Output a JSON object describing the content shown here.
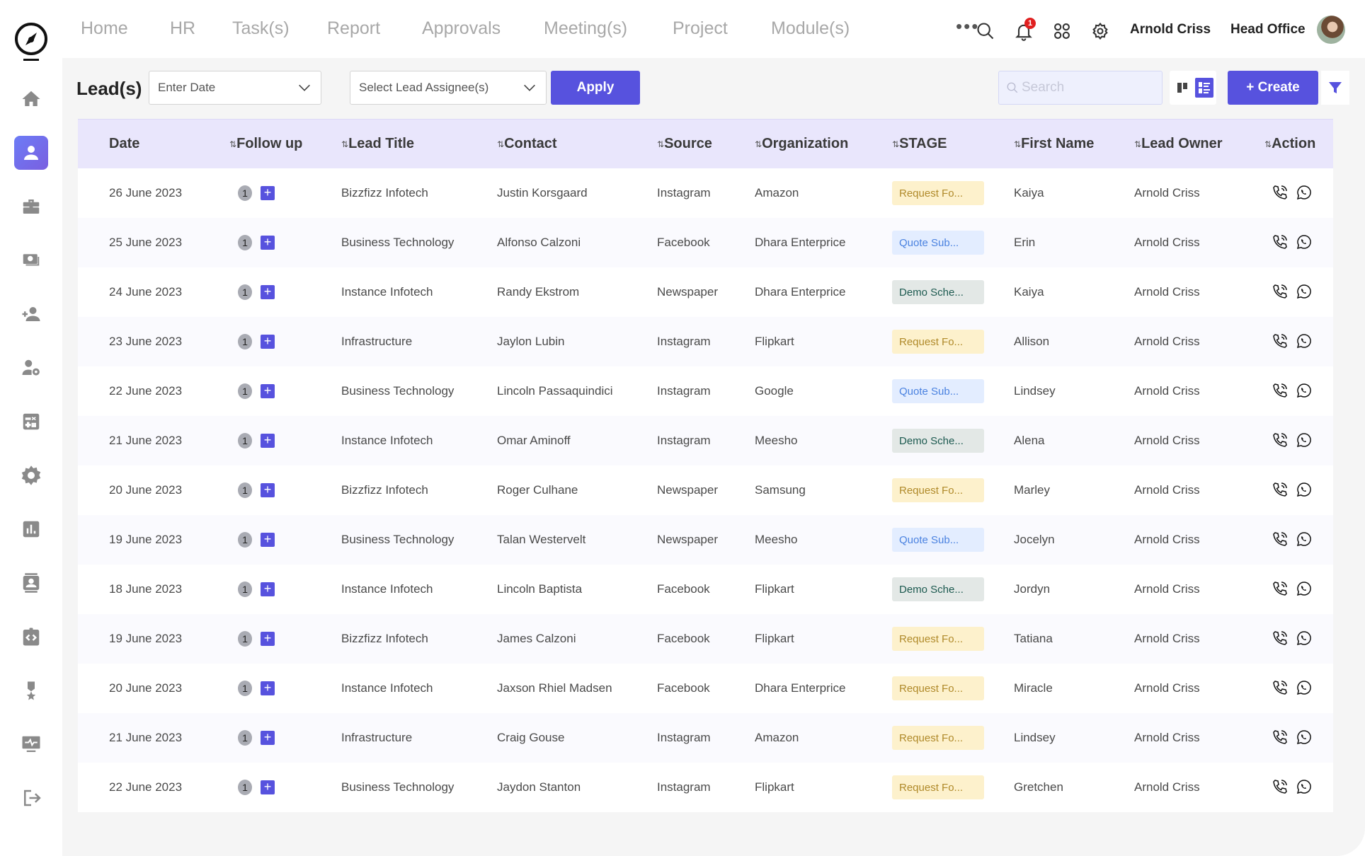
{
  "nav": {
    "links": [
      "Home",
      "HR",
      "Task(s)",
      "Report",
      "Approvals",
      "Meeting(s)",
      "Project",
      "Module(s)"
    ],
    "more_label": "•••",
    "notification_count": "1",
    "user_name": "Arnold Criss",
    "office": "Head Office"
  },
  "sidebar": {
    "items": [
      {
        "name": "home",
        "icon": "home-icon",
        "active": false
      },
      {
        "name": "leads",
        "icon": "person-icon",
        "active": true
      },
      {
        "name": "briefcase",
        "icon": "briefcase-icon",
        "active": false
      },
      {
        "name": "payments",
        "icon": "cash-icon",
        "active": false
      },
      {
        "name": "add-user",
        "icon": "person-add-icon",
        "active": false
      },
      {
        "name": "user-settings",
        "icon": "person-gear-icon",
        "active": false
      },
      {
        "name": "calculator",
        "icon": "calculator-icon",
        "active": false
      },
      {
        "name": "settings",
        "icon": "gear-icon",
        "active": false
      },
      {
        "name": "reports",
        "icon": "bar-chart-icon",
        "active": false
      },
      {
        "name": "contacts",
        "icon": "contact-card-icon",
        "active": false
      },
      {
        "name": "dev",
        "icon": "clipboard-code-icon",
        "active": false
      },
      {
        "name": "awards",
        "icon": "medal-icon",
        "active": false
      },
      {
        "name": "monitor",
        "icon": "monitor-pulse-icon",
        "active": false
      },
      {
        "name": "logout",
        "icon": "logout-icon",
        "active": false
      }
    ]
  },
  "toolbar": {
    "title": "Lead(s)",
    "date_placeholder": "Enter Date",
    "assignee_placeholder": "Select Lead Assignee(s)",
    "apply_label": "Apply",
    "search_placeholder": "Search",
    "create_label": "+ Create"
  },
  "colors": {
    "accent": "#5752de",
    "header_bg": "#e9e6fc",
    "request_bg": "#fdf1cc",
    "quote_bg": "#e3edff",
    "demo_bg": "#e3e8e6"
  },
  "table": {
    "columns": [
      "Date",
      "Follow up",
      "Lead Title",
      "Contact",
      "Source",
      "Organization",
      "STAGE",
      "First Name",
      "Lead Owner",
      "Action"
    ],
    "rows": [
      {
        "date": "26 June 2023",
        "followups": "1",
        "title": "Bizzfizz Infotech",
        "contact": "Justin Korsgaard",
        "source": "Instagram",
        "org": "Amazon",
        "stage": "Request Fo...",
        "stage_type": "request",
        "first": "Kaiya",
        "owner": "Arnold Criss"
      },
      {
        "date": "25 June 2023",
        "followups": "1",
        "title": "Business Technology",
        "contact": "Alfonso Calzoni",
        "source": "Facebook",
        "org": "Dhara Enterprice",
        "stage": "Quote Sub...",
        "stage_type": "quote",
        "first": "Erin",
        "owner": "Arnold Criss"
      },
      {
        "date": "24 June 2023",
        "followups": "1",
        "title": "Instance Infotech",
        "contact": "Randy Ekstrom",
        "source": "Newspaper",
        "org": "Dhara Enterprice",
        "stage": "Demo Sche...",
        "stage_type": "demo",
        "first": "Kaiya",
        "owner": "Arnold Criss"
      },
      {
        "date": "23 June 2023",
        "followups": "1",
        "title": "Infrastructure",
        "contact": "Jaylon Lubin",
        "source": "Instagram",
        "org": "Flipkart",
        "stage": "Request Fo...",
        "stage_type": "request",
        "first": "Allison",
        "owner": "Arnold Criss"
      },
      {
        "date": "22 June 2023",
        "followups": "1",
        "title": "Business Technology",
        "contact": "Lincoln Passaquindici",
        "source": "Instagram",
        "org": "Google",
        "stage": "Quote Sub...",
        "stage_type": "quote",
        "first": "Lindsey",
        "owner": "Arnold Criss"
      },
      {
        "date": "21 June 2023",
        "followups": "1",
        "title": "Instance Infotech",
        "contact": "Omar Aminoff",
        "source": "Instagram",
        "org": "Meesho",
        "stage": "Demo Sche...",
        "stage_type": "demo",
        "first": "Alena",
        "owner": "Arnold Criss"
      },
      {
        "date": "20 June 2023",
        "followups": "1",
        "title": "Bizzfizz Infotech",
        "contact": "Roger Culhane",
        "source": "Newspaper",
        "org": "Samsung",
        "stage": "Request Fo...",
        "stage_type": "request",
        "first": "Marley",
        "owner": "Arnold Criss"
      },
      {
        "date": "19 June 2023",
        "followups": "1",
        "title": "Business Technology",
        "contact": "Talan Westervelt",
        "source": "Newspaper",
        "org": "Meesho",
        "stage": "Quote Sub...",
        "stage_type": "quote",
        "first": "Jocelyn",
        "owner": "Arnold Criss"
      },
      {
        "date": "18 June 2023",
        "followups": "1",
        "title": "Instance Infotech",
        "contact": "Lincoln Baptista",
        "source": "Facebook",
        "org": "Flipkart",
        "stage": "Demo Sche...",
        "stage_type": "demo",
        "first": "Jordyn",
        "owner": "Arnold Criss"
      },
      {
        "date": "19 June 2023",
        "followups": "1",
        "title": "Bizzfizz Infotech",
        "contact": "James Calzoni",
        "source": "Facebook",
        "org": "Flipkart",
        "stage": "Request Fo...",
        "stage_type": "request",
        "first": "Tatiana",
        "owner": "Arnold Criss"
      },
      {
        "date": "20 June 2023",
        "followups": "1",
        "title": "Instance Infotech",
        "contact": "Jaxson Rhiel Madsen",
        "source": "Facebook",
        "org": "Dhara Enterprice",
        "stage": "Request Fo...",
        "stage_type": "request",
        "first": "Miracle",
        "owner": "Arnold Criss"
      },
      {
        "date": "21 June 2023",
        "followups": "1",
        "title": "Infrastructure",
        "contact": "Craig Gouse",
        "source": "Instagram",
        "org": "Amazon",
        "stage": "Request Fo...",
        "stage_type": "request",
        "first": "Lindsey",
        "owner": "Arnold Criss"
      },
      {
        "date": "22 June 2023",
        "followups": "1",
        "title": "Business Technology",
        "contact": "Jaydon Stanton",
        "source": "Instagram",
        "org": "Flipkart",
        "stage": "Request Fo...",
        "stage_type": "request",
        "first": "Gretchen",
        "owner": "Arnold Criss"
      }
    ]
  }
}
